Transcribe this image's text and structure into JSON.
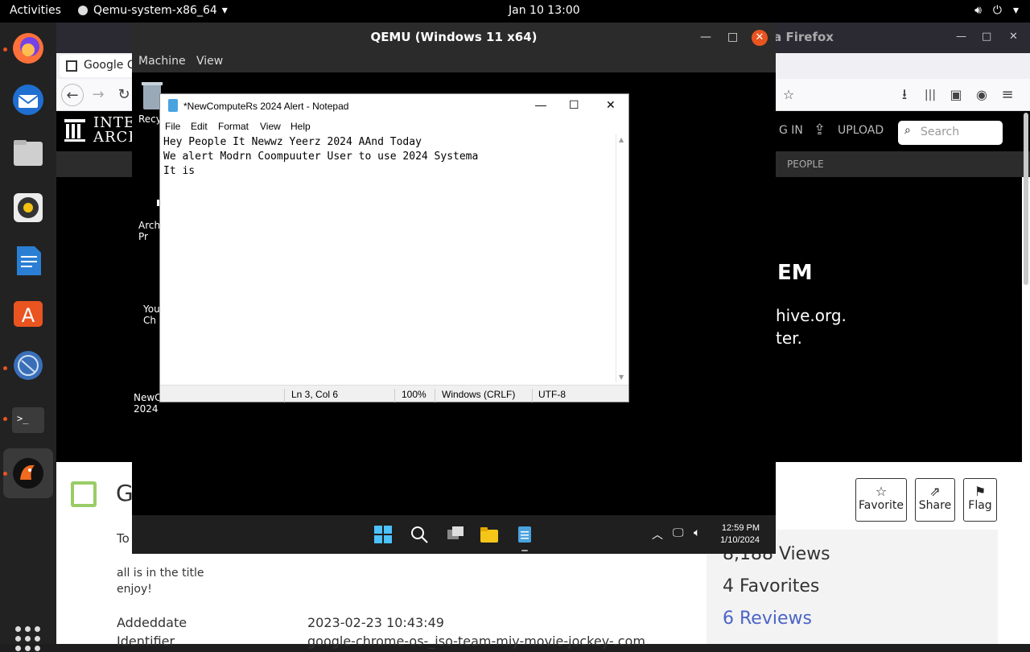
{
  "topbar": {
    "activities": "Activities",
    "app_name": "Qemu-system-x86_64",
    "clock": "Jan 10  13:00"
  },
  "firefox": {
    "window_title": "la Firefox",
    "tab_label": "Google Cl",
    "header": {
      "logo_line1": "INTE",
      "logo_line2": "ARCH",
      "login": "G IN",
      "upload": "UPLOAD",
      "search_placeholder": "Search"
    },
    "subnav_people": "PEOPLE",
    "hero": {
      "heading": "EM",
      "line1": "hive.org.",
      "line2": "ter."
    },
    "content": {
      "title_initial": "G",
      "topic_partial": "To",
      "desc_line1": "all is in the title",
      "desc_line2": "enjoy!",
      "buttons": {
        "favorite": "Favorite",
        "share": "Share",
        "flag": "Flag"
      },
      "stats": {
        "views": "8,188 Views",
        "favorites": "4 Favorites",
        "reviews": "6 Reviews"
      },
      "meta": {
        "addeddate_label": "Addeddate",
        "addeddate_value": "2023-02-23 10:43:49",
        "identifier_label": "Identifier",
        "identifier_value": "google-chrome-os-_iso-team-miy-movie-jockey-.com"
      }
    }
  },
  "qemu": {
    "title": "QEMU (Windows 11 x64)",
    "menu": {
      "machine": "Machine",
      "view": "View"
    },
    "desktop_icons": [
      "Recy",
      "Arch\nPr",
      "You\nCh",
      "NewC\n2024"
    ],
    "notepad": {
      "title": "*NewComputeRs 2024 Alert - Notepad",
      "menu": {
        "file": "File",
        "edit": "Edit",
        "format": "Format",
        "view": "View",
        "help": "Help"
      },
      "text": "Hey People It Newwz Yeerz 2024 AAnd Today\nWe alert Modrn Coompuuter User to use 2024 Systema\nIt is",
      "status": {
        "position": "Ln 3, Col 6",
        "zoom": "100%",
        "line_ending": "Windows (CRLF)",
        "encoding": "UTF-8"
      }
    },
    "taskbar": {
      "time": "12:59 PM",
      "date": "1/10/2024"
    }
  },
  "colors": {
    "ubuntu_orange": "#e95420",
    "reviews_link": "#4b64c8"
  }
}
